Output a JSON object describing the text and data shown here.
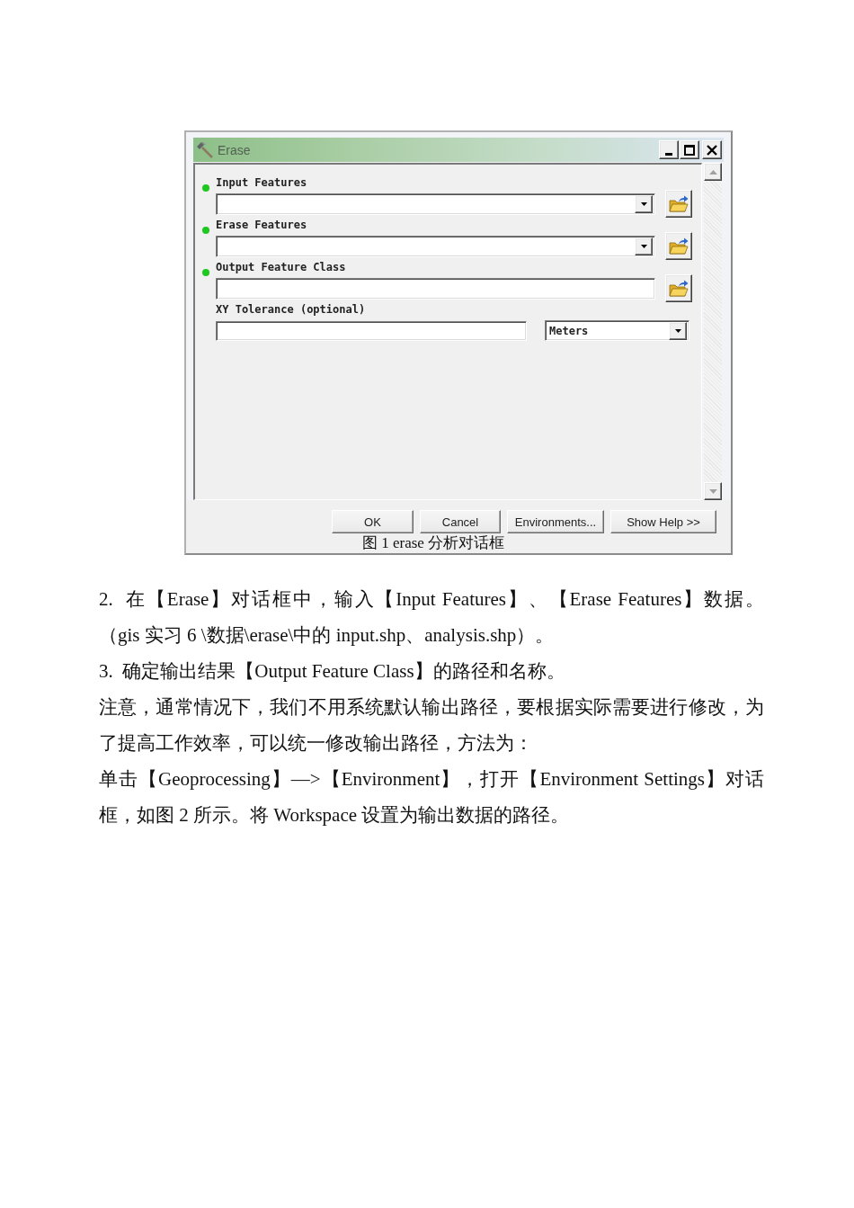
{
  "dialog": {
    "title": "Erase",
    "parameters": [
      {
        "kind": "combo",
        "label": "Input Features",
        "required": true
      },
      {
        "kind": "combo",
        "label": "Erase Features",
        "required": true
      },
      {
        "kind": "path",
        "label": "Output Feature Class",
        "required": true
      },
      {
        "kind": "tolerance",
        "label": "XY Tolerance (optional)",
        "required": false,
        "unit": "Meters"
      }
    ],
    "buttons": [
      "OK",
      "Cancel",
      "Environments...",
      "Show Help >>"
    ]
  },
  "caption": "图 1 erase 分析对话框",
  "paragraphs": [
    "2.  在【Erase】对话框中，输入【Input Features】、【Erase Features】数据。（gis 实习 6 \\数据\\erase\\中的 input.shp、analysis.shp）。",
    "3.  确定输出结果【Output Feature Class】的路径和名称。",
    "注意，通常情况下，我们不用系统默认输出路径，要根据实际需要进行修改，为了提高工作效率，可以统一修改输出路径，方法为：",
    "单击【Geoprocessing】—>【Environment】，打开【Environment Settings】对话框，如图 2 所示。将 Workspace 设置为输出数据的路径。"
  ]
}
